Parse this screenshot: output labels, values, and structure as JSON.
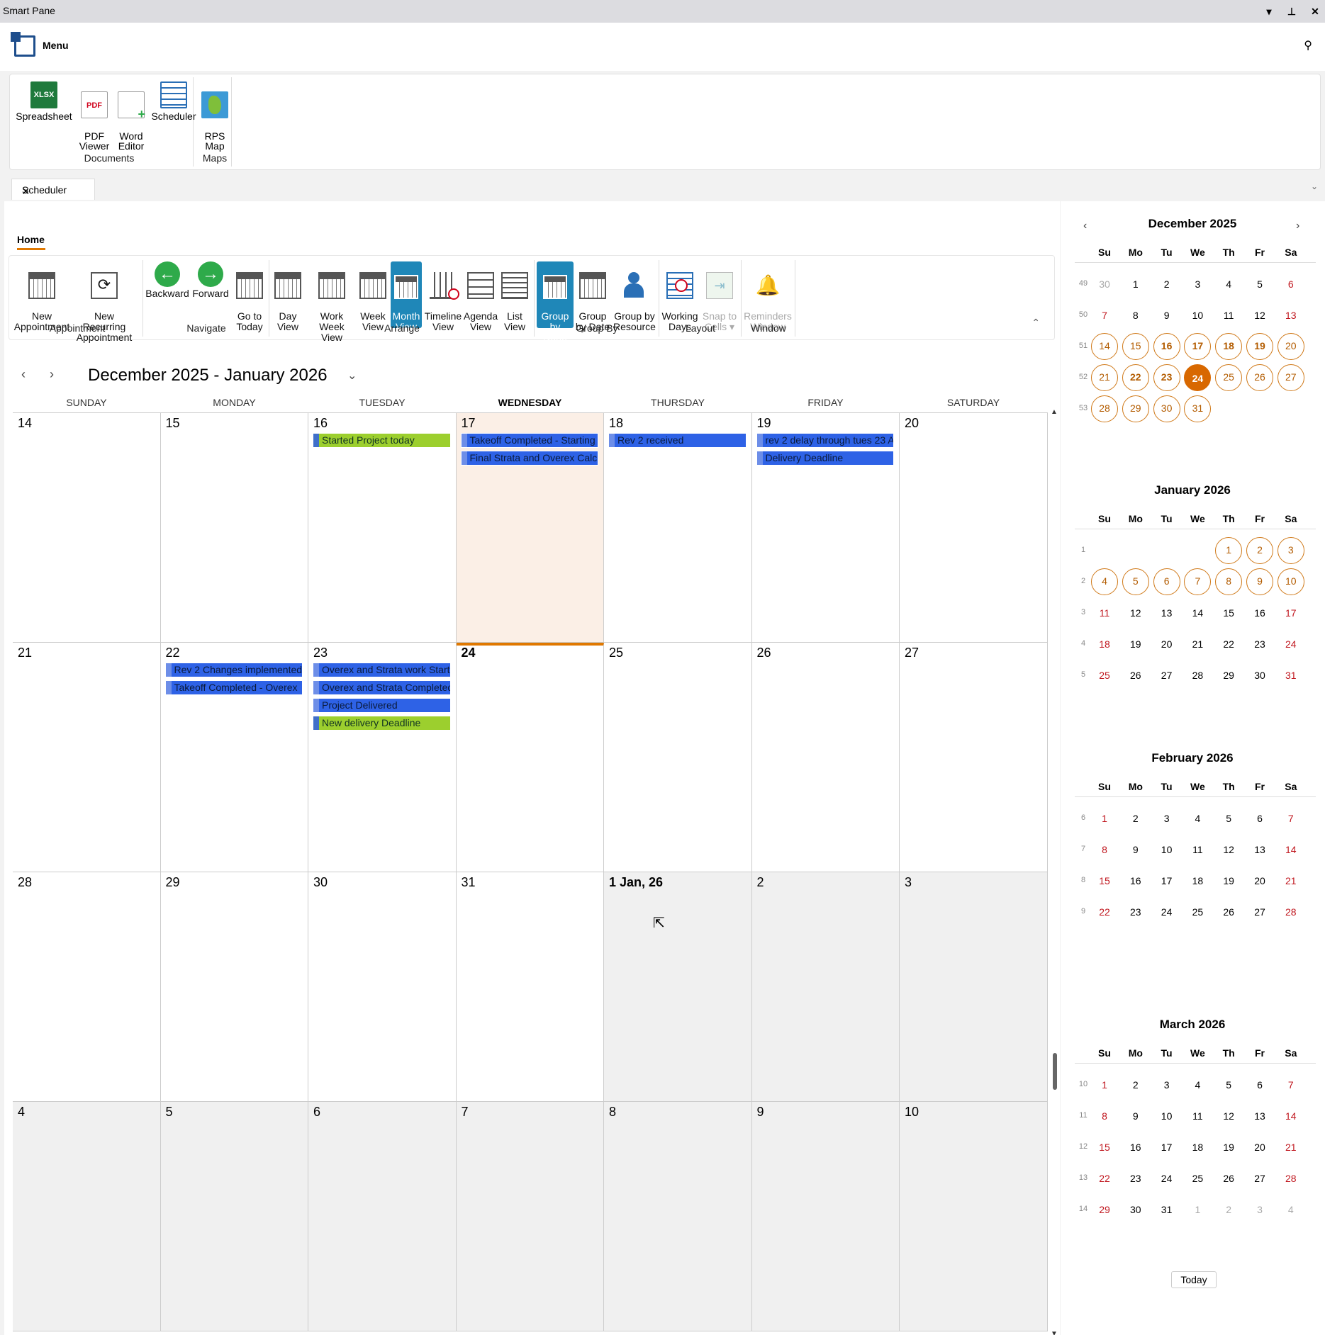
{
  "window": {
    "title": "Smart Pane",
    "controls": [
      "▾",
      "📌",
      "✕"
    ]
  },
  "menu": {
    "label": "Menu"
  },
  "doc_ribbon": {
    "buttons": [
      {
        "label": "Spreadsheet",
        "icon": "xlsx-icon",
        "badge": "XLSX"
      },
      {
        "label": "PDF\nViewer",
        "icon": "pdf-icon",
        "badge": "PDF"
      },
      {
        "label": "Word\nEditor",
        "icon": "word-icon",
        "badge": ""
      },
      {
        "label": "Scheduler",
        "icon": "scheduler-icon",
        "badge": ""
      },
      {
        "label": "RPS\nMap",
        "icon": "map-icon",
        "badge": ""
      }
    ],
    "groups": [
      "Documents",
      "Maps"
    ]
  },
  "tab": {
    "label": "Scheduler"
  },
  "ribbon": {
    "home_tab": "Home",
    "buttons": [
      {
        "label": "New\nAppointment",
        "icon": "calendar-icon"
      },
      {
        "label": "New Recurring\nAppointment",
        "icon": "recurring-icon"
      },
      {
        "label": "Backward",
        "icon": "arrow-left-icon"
      },
      {
        "label": "Forward",
        "icon": "arrow-right-icon"
      },
      {
        "label": "Go to\nToday",
        "icon": "calendar-today-icon"
      },
      {
        "label": "Day\nView",
        "icon": "day-view-icon"
      },
      {
        "label": "Work Week\nView",
        "icon": "work-week-icon"
      },
      {
        "label": "Week\nView",
        "icon": "week-view-icon"
      },
      {
        "label": "Month\nView",
        "icon": "month-view-icon"
      },
      {
        "label": "Timeline\nView",
        "icon": "timeline-icon"
      },
      {
        "label": "Agenda\nView",
        "icon": "agenda-icon"
      },
      {
        "label": "List\nView",
        "icon": "list-icon"
      },
      {
        "label": "Group\nby None",
        "icon": "group-none-icon"
      },
      {
        "label": "Group\nby Date",
        "icon": "group-date-icon"
      },
      {
        "label": "Group by\nResource",
        "icon": "group-resource-icon"
      },
      {
        "label": "Working\nDays",
        "icon": "working-days-icon"
      },
      {
        "label": "Snap to\nCells ▾",
        "icon": "snap-icon"
      },
      {
        "label": "Reminders\nWindow",
        "icon": "bell-icon"
      }
    ],
    "groups": [
      "Appointment",
      "Navigate",
      "Arrange",
      "Group By",
      "Layout",
      "Window"
    ]
  },
  "calendar": {
    "title": "December 2025 - January 2026",
    "days": [
      "SUNDAY",
      "MONDAY",
      "TUESDAY",
      "WEDNESDAY",
      "THURSDAY",
      "FRIDAY",
      "SATURDAY"
    ],
    "weeks": [
      [
        "14",
        "15",
        "16",
        "17",
        "18",
        "19",
        "20"
      ],
      [
        "21",
        "22",
        "23",
        "24",
        "25",
        "26",
        "27"
      ],
      [
        "28",
        "29",
        "30",
        "31",
        "1 Jan, 26",
        "2",
        "3"
      ],
      [
        "4",
        "5",
        "6",
        "7",
        "8",
        "9",
        "10"
      ]
    ],
    "appointments": [
      {
        "week": 0,
        "day": 2,
        "slot": 0,
        "text": "Started Project today",
        "color": "green"
      },
      {
        "week": 0,
        "day": 3,
        "slot": 0,
        "text": "Takeoff Completed - Starting",
        "color": "blue"
      },
      {
        "week": 0,
        "day": 3,
        "slot": 1,
        "text": "Final Strata and Overex Calc",
        "color": "blue"
      },
      {
        "week": 0,
        "day": 4,
        "slot": 0,
        "text": "Rev 2 received",
        "color": "blue"
      },
      {
        "week": 0,
        "day": 5,
        "slot": 0,
        "text": "rev 2 delay through tues 23 A",
        "color": "blue"
      },
      {
        "week": 0,
        "day": 5,
        "slot": 1,
        "text": "Delivery Deadline",
        "color": "blue"
      },
      {
        "week": 1,
        "day": 1,
        "slot": 0,
        "text": "Rev 2 Changes implemented",
        "color": "blue"
      },
      {
        "week": 1,
        "day": 1,
        "slot": 1,
        "text": "Takeoff Completed - Overex",
        "color": "blue"
      },
      {
        "week": 1,
        "day": 2,
        "slot": 0,
        "text": "Overex and Strata work Start",
        "color": "blue"
      },
      {
        "week": 1,
        "day": 2,
        "slot": 1,
        "text": "Overex and Strata Completed",
        "color": "blue"
      },
      {
        "week": 1,
        "day": 2,
        "slot": 2,
        "text": "Project Delivered",
        "color": "blue"
      },
      {
        "week": 1,
        "day": 2,
        "slot": 3,
        "text": "New delivery Deadline",
        "color": "green"
      }
    ]
  },
  "mini": {
    "headers": [
      "Su",
      "Mo",
      "Tu",
      "We",
      "Th",
      "Fr",
      "Sa"
    ],
    "months": [
      {
        "title": "December 2025",
        "weeks": [
          {
            "wk": "49",
            "days": [
              [
                "30",
                "gray"
              ],
              [
                "1",
                ""
              ],
              [
                "2",
                ""
              ],
              [
                "3",
                ""
              ],
              [
                "4",
                ""
              ],
              [
                "5",
                ""
              ],
              [
                "6",
                "wknd"
              ]
            ]
          },
          {
            "wk": "50",
            "days": [
              [
                "7",
                "wknd"
              ],
              [
                "8",
                ""
              ],
              [
                "9",
                ""
              ],
              [
                "10",
                ""
              ],
              [
                "11",
                ""
              ],
              [
                "12",
                ""
              ],
              [
                "13",
                "wknd"
              ]
            ]
          },
          {
            "wk": "51",
            "days": [
              [
                "14",
                "sel"
              ],
              [
                "15",
                "sel"
              ],
              [
                "16",
                "sel bold"
              ],
              [
                "17",
                "sel bold"
              ],
              [
                "18",
                "sel bold"
              ],
              [
                "19",
                "sel bold"
              ],
              [
                "20",
                "sel"
              ]
            ]
          },
          {
            "wk": "52",
            "days": [
              [
                "21",
                "sel"
              ],
              [
                "22",
                "sel bold"
              ],
              [
                "23",
                "sel bold"
              ],
              [
                "24",
                "today bold"
              ],
              [
                "25",
                "sel"
              ],
              [
                "26",
                "sel"
              ],
              [
                "27",
                "sel"
              ]
            ]
          },
          {
            "wk": "53",
            "days": [
              [
                "28",
                "sel"
              ],
              [
                "29",
                "sel"
              ],
              [
                "30",
                "sel"
              ],
              [
                "31",
                "sel"
              ]
            ]
          }
        ]
      },
      {
        "title": "January 2026",
        "weeks": [
          {
            "wk": "1",
            "days": [
              [
                "",
                ""
              ],
              [
                "",
                ""
              ],
              [
                "",
                ""
              ],
              [
                "",
                ""
              ],
              [
                "1",
                "sel"
              ],
              [
                "2",
                "sel"
              ],
              [
                "3",
                "sel"
              ]
            ]
          },
          {
            "wk": "2",
            "days": [
              [
                "4",
                "sel"
              ],
              [
                "5",
                "sel"
              ],
              [
                "6",
                "sel"
              ],
              [
                "7",
                "sel"
              ],
              [
                "8",
                "sel"
              ],
              [
                "9",
                "sel"
              ],
              [
                "10",
                "sel"
              ]
            ]
          },
          {
            "wk": "3",
            "days": [
              [
                "11",
                "wknd"
              ],
              [
                "12",
                ""
              ],
              [
                "13",
                ""
              ],
              [
                "14",
                ""
              ],
              [
                "15",
                ""
              ],
              [
                "16",
                ""
              ],
              [
                "17",
                "wknd"
              ]
            ]
          },
          {
            "wk": "4",
            "days": [
              [
                "18",
                "wknd"
              ],
              [
                "19",
                ""
              ],
              [
                "20",
                ""
              ],
              [
                "21",
                ""
              ],
              [
                "22",
                ""
              ],
              [
                "23",
                ""
              ],
              [
                "24",
                "wknd"
              ]
            ]
          },
          {
            "wk": "5",
            "days": [
              [
                "25",
                "wknd"
              ],
              [
                "26",
                ""
              ],
              [
                "27",
                ""
              ],
              [
                "28",
                ""
              ],
              [
                "29",
                ""
              ],
              [
                "30",
                ""
              ],
              [
                "31",
                "wknd"
              ]
            ]
          }
        ]
      },
      {
        "title": "February 2026",
        "weeks": [
          {
            "wk": "6",
            "days": [
              [
                "1",
                "wknd"
              ],
              [
                "2",
                ""
              ],
              [
                "3",
                ""
              ],
              [
                "4",
                ""
              ],
              [
                "5",
                ""
              ],
              [
                "6",
                ""
              ],
              [
                "7",
                "wknd"
              ]
            ]
          },
          {
            "wk": "7",
            "days": [
              [
                "8",
                "wknd"
              ],
              [
                "9",
                ""
              ],
              [
                "10",
                ""
              ],
              [
                "11",
                ""
              ],
              [
                "12",
                ""
              ],
              [
                "13",
                ""
              ],
              [
                "14",
                "wknd"
              ]
            ]
          },
          {
            "wk": "8",
            "days": [
              [
                "15",
                "wknd"
              ],
              [
                "16",
                ""
              ],
              [
                "17",
                ""
              ],
              [
                "18",
                ""
              ],
              [
                "19",
                ""
              ],
              [
                "20",
                ""
              ],
              [
                "21",
                "wknd"
              ]
            ]
          },
          {
            "wk": "9",
            "days": [
              [
                "22",
                "wknd"
              ],
              [
                "23",
                ""
              ],
              [
                "24",
                ""
              ],
              [
                "25",
                ""
              ],
              [
                "26",
                ""
              ],
              [
                "27",
                ""
              ],
              [
                "28",
                "wknd"
              ]
            ]
          }
        ]
      },
      {
        "title": "March 2026",
        "weeks": [
          {
            "wk": "10",
            "days": [
              [
                "1",
                "wknd"
              ],
              [
                "2",
                ""
              ],
              [
                "3",
                ""
              ],
              [
                "4",
                ""
              ],
              [
                "5",
                ""
              ],
              [
                "6",
                ""
              ],
              [
                "7",
                "wknd"
              ]
            ]
          },
          {
            "wk": "11",
            "days": [
              [
                "8",
                "wknd"
              ],
              [
                "9",
                ""
              ],
              [
                "10",
                ""
              ],
              [
                "11",
                ""
              ],
              [
                "12",
                ""
              ],
              [
                "13",
                ""
              ],
              [
                "14",
                "wknd"
              ]
            ]
          },
          {
            "wk": "12",
            "days": [
              [
                "15",
                "wknd"
              ],
              [
                "16",
                ""
              ],
              [
                "17",
                ""
              ],
              [
                "18",
                ""
              ],
              [
                "19",
                ""
              ],
              [
                "20",
                ""
              ],
              [
                "21",
                "wknd"
              ]
            ]
          },
          {
            "wk": "13",
            "days": [
              [
                "22",
                "wknd"
              ],
              [
                "23",
                ""
              ],
              [
                "24",
                ""
              ],
              [
                "25",
                ""
              ],
              [
                "26",
                ""
              ],
              [
                "27",
                ""
              ],
              [
                "28",
                "wknd"
              ]
            ]
          },
          {
            "wk": "14",
            "days": [
              [
                "29",
                "wknd"
              ],
              [
                "30",
                ""
              ],
              [
                "31",
                ""
              ],
              [
                "1",
                "gray"
              ],
              [
                "2",
                "gray"
              ],
              [
                "3",
                "gray"
              ],
              [
                "4",
                "gray"
              ]
            ]
          }
        ]
      }
    ],
    "today_label": "Today"
  },
  "colors": {
    "accent": "#e07800",
    "appt_blue": "#2e62e6",
    "appt_green": "#9ccf2e",
    "active_button": "#1f87b8",
    "weekend": "#c0161e"
  }
}
